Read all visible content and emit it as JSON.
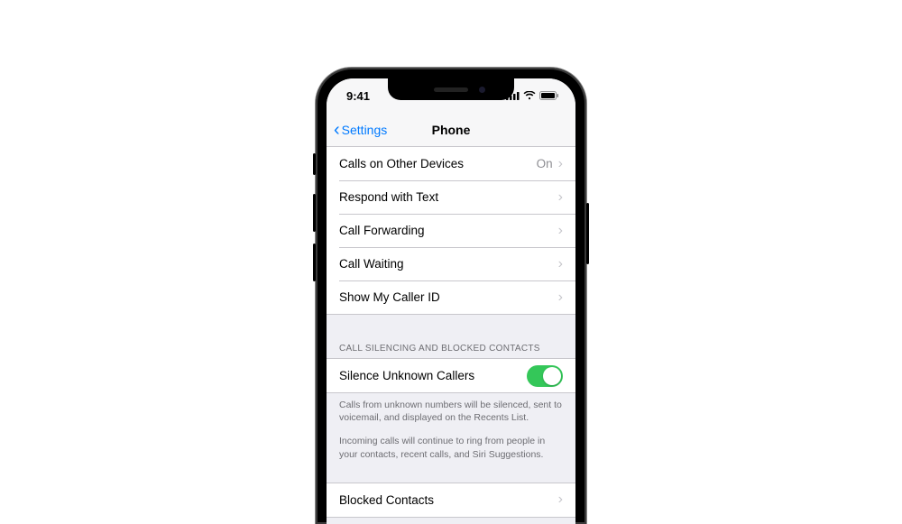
{
  "status": {
    "time": "9:41"
  },
  "nav": {
    "back": "Settings",
    "title": "Phone"
  },
  "rows": {
    "calls_other": "Calls on Other Devices",
    "calls_other_value": "On",
    "respond_text": "Respond with Text",
    "call_forwarding": "Call Forwarding",
    "call_waiting": "Call Waiting",
    "show_caller_id": "Show My Caller ID",
    "silence_unknown": "Silence Unknown Callers",
    "blocked_contacts": "Blocked Contacts"
  },
  "section_header": "CALL SILENCING AND BLOCKED CONTACTS",
  "footer1": "Calls from unknown numbers will be silenced, sent to voicemail, and displayed on the Recents List.",
  "footer2": "Incoming calls will continue to ring from people in your contacts, recent calls, and Siri Suggestions.",
  "toggle": {
    "silence_unknown_on": true
  }
}
